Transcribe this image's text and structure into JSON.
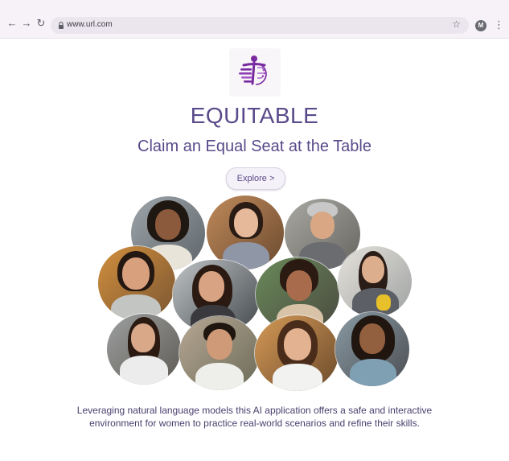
{
  "browser": {
    "url": "www.url.com",
    "back_icon": "arrow-left-icon",
    "forward_icon": "arrow-right-icon",
    "reload_icon": "reload-icon",
    "lock_icon": "lock-icon",
    "bookmark_icon": "star-icon",
    "profile_initial": "M",
    "menu_icon": "kebab-menu-icon"
  },
  "hero": {
    "logo_icon": "equitable-logo",
    "brand": "EQUITABLE",
    "tagline": "Claim an Equal Seat at the Table",
    "explore_label": "Explore >",
    "description": "Leveraging natural language models this AI application offers a safe and interactive environment for women to practice real-world scenarios and refine their skills."
  },
  "colors": {
    "brand_text": "#5a4a8a",
    "logo_purple": "#7a2aa0",
    "chrome_bg": "#f6f2f8",
    "omnibox_bg": "#ebe6ee"
  },
  "collage": {
    "portrait_count": 11
  }
}
